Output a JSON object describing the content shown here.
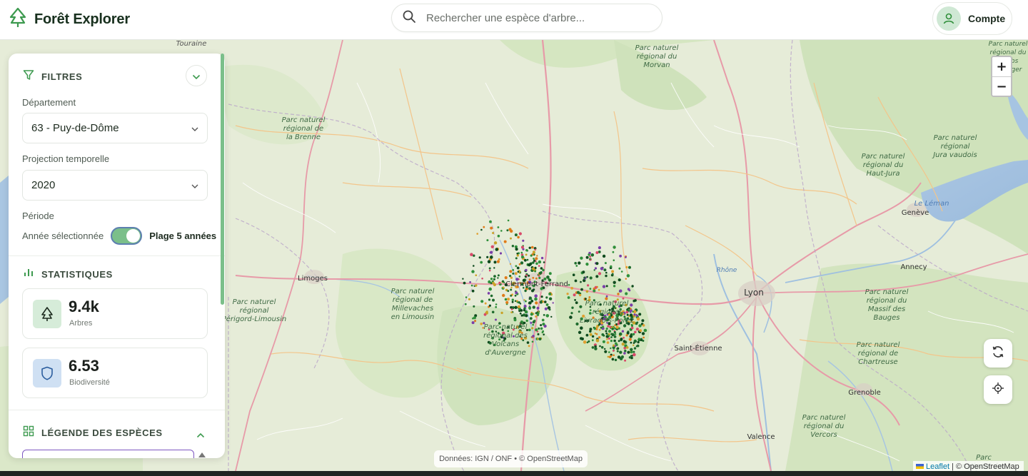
{
  "app": {
    "title": "Forêt Explorer"
  },
  "search": {
    "placeholder": "Rechercher une espèce d'arbre..."
  },
  "account": {
    "label": "Compte"
  },
  "sidebar": {
    "filters": {
      "title": "FILTRES",
      "department_label": "Département",
      "department_value": "63 - Puy-de-Dôme",
      "projection_label": "Projection temporelle",
      "projection_value": "2020",
      "period_label": "Période",
      "period_option_left": "Année sélectionnée",
      "period_option_right": "Plage 5 années",
      "period_range_selected": true
    },
    "statistics": {
      "title": "STATISTIQUES",
      "cards": [
        {
          "value": "9.4k",
          "label": "Arbres",
          "icon": "tree-icon",
          "color": "#d6ecd9"
        },
        {
          "value": "6.53",
          "label": "Biodiversité",
          "icon": "shield-icon",
          "color": "#cfe0f3"
        }
      ]
    },
    "legend": {
      "title": "LÉGENDE DES ESPÈCES"
    }
  },
  "map": {
    "zoom_in": "+",
    "zoom_out": "−",
    "labels": {
      "touraine": "Touraine",
      "morvan": "Parc naturel régional du Morvan",
      "brenne": "Parc naturel régional de la Brenne",
      "jura": "Parc naturel régional du Haut-Jura",
      "jura_vaudois": "Parc naturel régional Jura vaudois",
      "doubs": "Parc naturel régional du Doubs Horloger",
      "millevaches": "Parc naturel régional de Millevaches en Limousin",
      "perigord": "Parc naturel régional Périgord-Limousin",
      "volcans": "Parc naturel régional des Volcans d'Auvergne",
      "livradois": "Parc naturel régional Livradois-Forez",
      "bauges": "Parc naturel régional du Massif des Bauges",
      "chartreuse": "Parc naturel régional de Chartreuse",
      "vercors": "Parc naturel régional du Vercors",
      "ecrins": "Parc national des Écrins",
      "limoges": "Limoges",
      "clermont": "Clermont-Ferrand",
      "lyon": "Lyon",
      "saint_etienne": "Saint-Étienne",
      "geneve": "Genève",
      "annecy": "Annecy",
      "grenoble": "Grenoble",
      "valence": "Valence",
      "rhone": "Rhône",
      "leman": "Le Léman"
    },
    "attribution": "Données: IGN / ONF • © OpenStreetMap",
    "leaflet_link": "Leaflet",
    "osm_attribution": "| © OpenStreetMap",
    "point_colors": [
      "#1e6b2d",
      "#2f8f3a",
      "#0f4a1e",
      "#e07b1a",
      "#d84a6a",
      "#7a3fa8",
      "#c9a227",
      "#e0a030"
    ]
  }
}
